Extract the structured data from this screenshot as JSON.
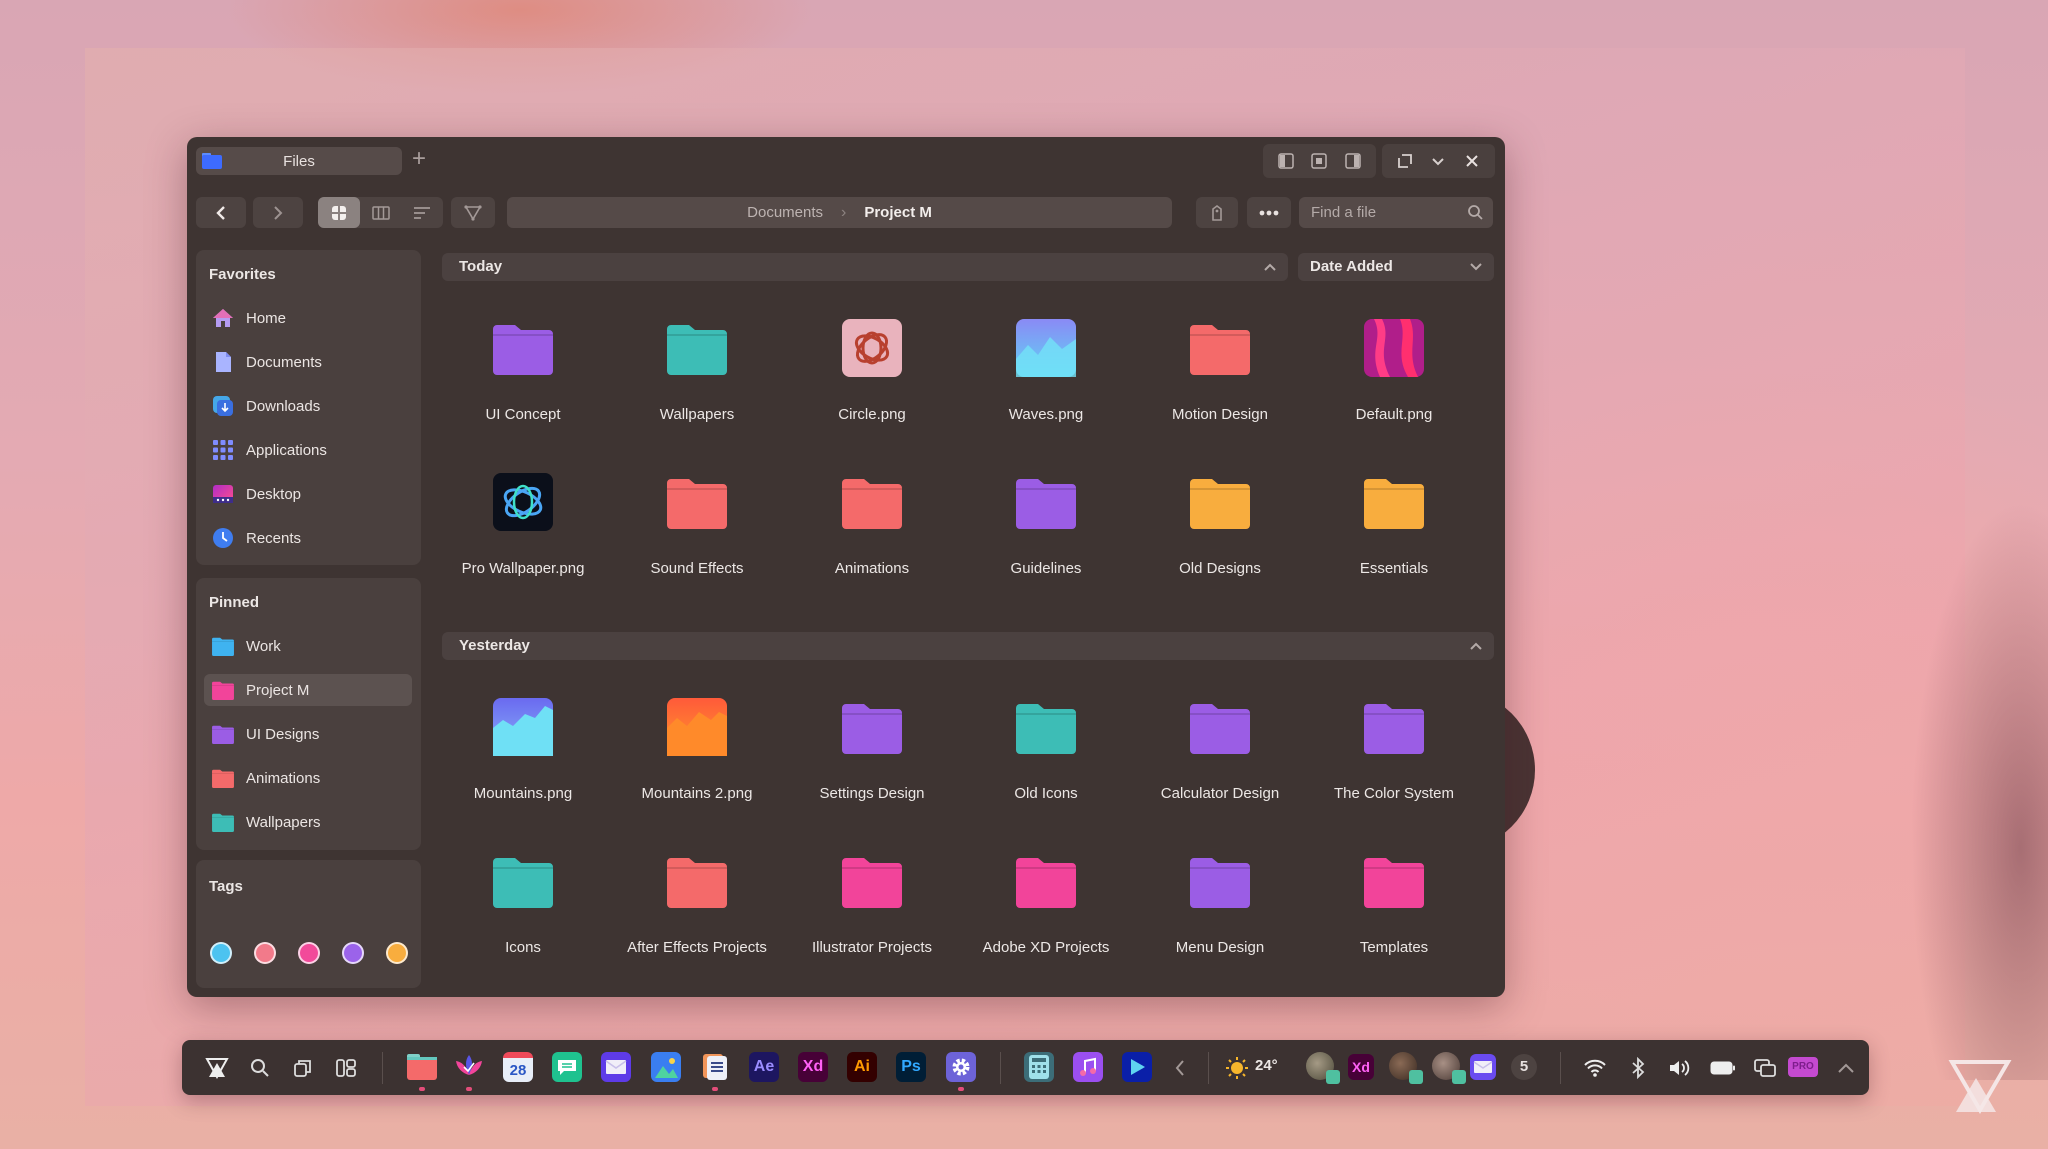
{
  "window": {
    "tab_title": "Files",
    "new_tab_label": "+",
    "controls": [
      "sidebar-left-icon",
      "center-panel-icon",
      "sidebar-right-icon",
      "restore-icon",
      "minimize-icon",
      "close-icon"
    ]
  },
  "toolbar": {
    "back": "back-icon",
    "forward": "forward-icon",
    "views": [
      {
        "name": "grid-view-icon",
        "active": true
      },
      {
        "name": "column-view-icon",
        "active": false
      },
      {
        "name": "list-view-icon",
        "active": false
      }
    ],
    "filter": "filter-icon",
    "breadcrumb": [
      "Documents",
      "Project M"
    ],
    "tag_button": "tag-icon",
    "more_button": "more-icon",
    "search_placeholder": "Find a file",
    "search_value": ""
  },
  "sidebar": {
    "favorites_title": "Favorites",
    "favorites": [
      {
        "label": "Home",
        "icon": "home-icon"
      },
      {
        "label": "Documents",
        "icon": "document-icon"
      },
      {
        "label": "Downloads",
        "icon": "download-icon"
      },
      {
        "label": "Applications",
        "icon": "applications-icon"
      },
      {
        "label": "Desktop",
        "icon": "desktop-icon"
      },
      {
        "label": "Recents",
        "icon": "clock-icon"
      }
    ],
    "pinned_title": "Pinned",
    "pinned": [
      {
        "label": "Work",
        "color": "#3fb3f0",
        "active": false
      },
      {
        "label": "Project M",
        "color": "#f2449a",
        "active": true
      },
      {
        "label": "UI Designs",
        "color": "#9b5de5",
        "active": false
      },
      {
        "label": "Animations",
        "color": "#f46a6a",
        "active": false
      },
      {
        "label": "Wallpapers",
        "color": "#3dbdb6",
        "active": false
      }
    ],
    "tags_title": "Tags",
    "tags": [
      "#4cc3f0",
      "#f27a8a",
      "#f24a9a",
      "#9b63ea",
      "#f8ad3e"
    ]
  },
  "main": {
    "sort_label": "Date Added",
    "sections": [
      {
        "title": "Today",
        "items": [
          {
            "name": "UI Concept",
            "type": "folder",
            "color": "#9b5de5"
          },
          {
            "name": "Wallpapers",
            "type": "folder",
            "color": "#3dbdb6"
          },
          {
            "name": "Circle.png",
            "type": "image",
            "thumb": "circle"
          },
          {
            "name": "Waves.png",
            "type": "image",
            "thumb": "waves"
          },
          {
            "name": "Motion Design",
            "type": "folder",
            "color": "#f46a6a"
          },
          {
            "name": "Default.png",
            "type": "image",
            "thumb": "default"
          },
          {
            "name": "Pro Wallpaper.png",
            "type": "image",
            "thumb": "pro"
          },
          {
            "name": "Sound Effects",
            "type": "folder",
            "color": "#f46a6a"
          },
          {
            "name": "Animations",
            "type": "folder",
            "color": "#f46a6a"
          },
          {
            "name": "Guidelines",
            "type": "folder",
            "color": "#9b5de5"
          },
          {
            "name": "Old Designs",
            "type": "folder",
            "color": "#f8ad3e"
          },
          {
            "name": "Essentials",
            "type": "folder",
            "color": "#f8ad3e"
          }
        ]
      },
      {
        "title": "Yesterday",
        "items": [
          {
            "name": "Mountains.png",
            "type": "image",
            "thumb": "mountains"
          },
          {
            "name": "Mountains 2.png",
            "type": "image",
            "thumb": "mountains2"
          },
          {
            "name": "Settings Design",
            "type": "folder",
            "color": "#9b5de5"
          },
          {
            "name": "Old Icons",
            "type": "folder",
            "color": "#3dbdb6"
          },
          {
            "name": "Calculator Design",
            "type": "folder",
            "color": "#9b5de5"
          },
          {
            "name": "The Color System",
            "type": "folder",
            "color": "#9b5de5"
          },
          {
            "name": "Icons",
            "type": "folder",
            "color": "#3dbdb6"
          },
          {
            "name": "After Effects Projects",
            "type": "folder",
            "color": "#f46a6a"
          },
          {
            "name": "Illustrator Projects",
            "type": "folder",
            "color": "#f2449a"
          },
          {
            "name": "Adobe XD Projects",
            "type": "folder",
            "color": "#f2449a"
          },
          {
            "name": "Menu Design",
            "type": "folder",
            "color": "#9b5de5"
          },
          {
            "name": "Templates",
            "type": "folder",
            "color": "#f2449a"
          }
        ]
      }
    ]
  },
  "taskbar": {
    "system_left": [
      "launcher-logo-icon",
      "search-icon",
      "task-view-icon",
      "widgets-icon"
    ],
    "apps": [
      {
        "name": "files-app-icon",
        "running": true
      },
      {
        "name": "lotus-app-icon",
        "running": true
      },
      {
        "name": "calendar-app-icon",
        "label": "28",
        "running": false
      },
      {
        "name": "messages-app-icon",
        "running": false
      },
      {
        "name": "mail-app-icon",
        "running": false
      },
      {
        "name": "photos-app-icon",
        "running": false
      },
      {
        "name": "notes-app-icon",
        "running": true
      },
      {
        "name": "after-effects-app-icon",
        "label": "Ae",
        "running": false
      },
      {
        "name": "xd-app-icon",
        "label": "Xd",
        "running": false
      },
      {
        "name": "illustrator-app-icon",
        "label": "Ai",
        "running": false
      },
      {
        "name": "photoshop-app-icon",
        "label": "Ps",
        "running": false
      },
      {
        "name": "settings-app-icon",
        "running": true
      }
    ],
    "apps_right": [
      "calculator-app-icon",
      "music-app-icon",
      "media-player-app-icon"
    ],
    "weather": {
      "icon": "sun-icon",
      "temp": "24°"
    },
    "notification_count": "5",
    "pro_label": "PRO"
  }
}
